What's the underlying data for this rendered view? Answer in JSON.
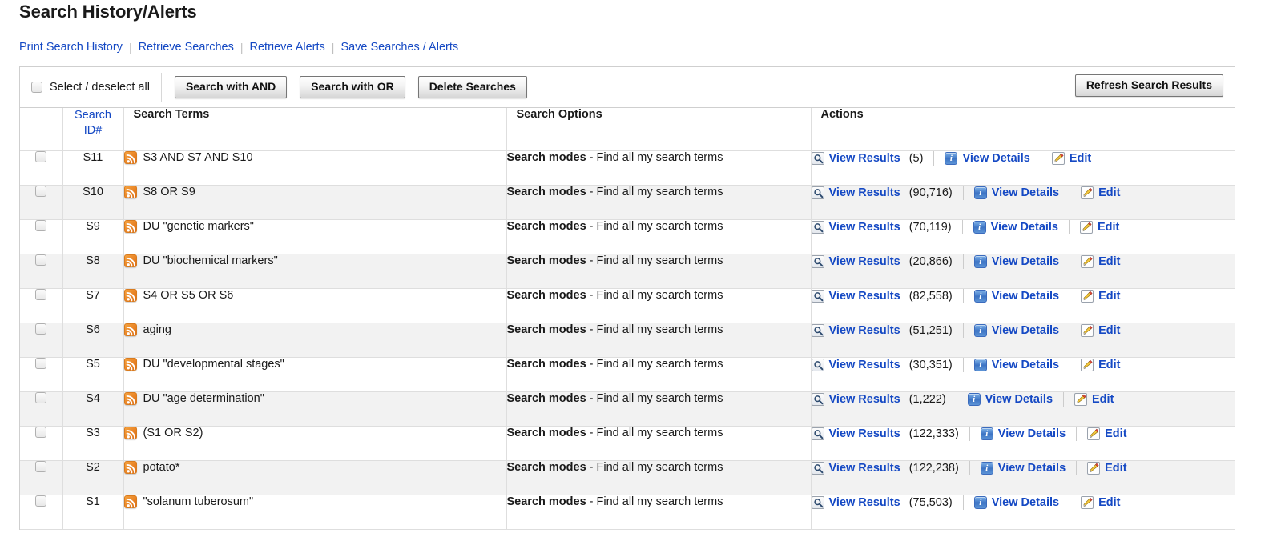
{
  "page": {
    "title": "Search History/Alerts"
  },
  "linkbar": {
    "items": [
      {
        "label": "Print Search History",
        "name": "print-search-history-link"
      },
      {
        "label": "Retrieve Searches",
        "name": "retrieve-searches-link"
      },
      {
        "label": "Retrieve Alerts",
        "name": "retrieve-alerts-link"
      },
      {
        "label": "Save Searches / Alerts",
        "name": "save-searches-alerts-link"
      }
    ]
  },
  "toolbar": {
    "select_all_label": "Select / deselect all",
    "search_and_label": "Search with AND",
    "search_or_label": "Search with OR",
    "delete_label": "Delete Searches",
    "refresh_label": "Refresh Search Results"
  },
  "table": {
    "headers": {
      "checkbox": "",
      "search_id": "Search ID#",
      "search_id_line1": "Search",
      "search_id_line2": "ID#",
      "search_terms": "Search Terms",
      "search_options": "Search Options",
      "actions": "Actions"
    },
    "action_labels": {
      "view_results": "View Results",
      "view_details": "View Details",
      "edit": "Edit"
    },
    "search_options_prefix": "Search modes",
    "search_options_value": " - Find all my search terms",
    "rows": [
      {
        "id": "S11",
        "terms": "S3 AND S7 AND S10",
        "options_prefix": "Search modes",
        "options_value": " - Find all my search terms",
        "count": "(5)"
      },
      {
        "id": "S10",
        "terms": "S8 OR S9",
        "options_prefix": "Search modes",
        "options_value": " - Find all my search terms",
        "count": "(90,716)"
      },
      {
        "id": "S9",
        "terms": "DU \"genetic markers\"",
        "options_prefix": "Search modes",
        "options_value": " - Find all my search terms",
        "count": "(70,119)"
      },
      {
        "id": "S8",
        "terms": "DU \"biochemical markers\"",
        "options_prefix": "Search modes",
        "options_value": " - Find all my search terms",
        "count": "(20,866)"
      },
      {
        "id": "S7",
        "terms": "S4 OR S5 OR S6",
        "options_prefix": "Search modes",
        "options_value": " - Find all my search terms",
        "count": "(82,558)"
      },
      {
        "id": "S6",
        "terms": "aging",
        "options_prefix": "Search modes",
        "options_value": " - Find all my search terms",
        "count": "(51,251)"
      },
      {
        "id": "S5",
        "terms": "DU \"developmental stages\"",
        "options_prefix": "Search modes",
        "options_value": " - Find all my search terms",
        "count": "(30,351)"
      },
      {
        "id": "S4",
        "terms": "DU \"age determination\"",
        "options_prefix": "Search modes",
        "options_value": " - Find all my search terms",
        "count": "(1,222)"
      },
      {
        "id": "S3",
        "terms": "(S1 OR S2)",
        "options_prefix": "Search modes",
        "options_value": " - Find all my search terms",
        "count": "(122,333)"
      },
      {
        "id": "S2",
        "terms": "potato*",
        "options_prefix": "Search modes",
        "options_value": " - Find all my search terms",
        "count": "(122,238)"
      },
      {
        "id": "S1",
        "terms": "\"solanum tuberosum\"",
        "options_prefix": "Search modes",
        "options_value": " - Find all my search terms",
        "count": "(75,503)"
      }
    ]
  },
  "icons": {
    "rss": "rss-icon",
    "magnifier": "magnifier-icon",
    "info": "info-icon",
    "edit": "edit-pencil-icon",
    "info_glyph": "i"
  },
  "colors": {
    "link": "#1549c4",
    "rss_orange": "#e98426",
    "row_alt": "#f2f2f2",
    "border": "#dedede"
  }
}
